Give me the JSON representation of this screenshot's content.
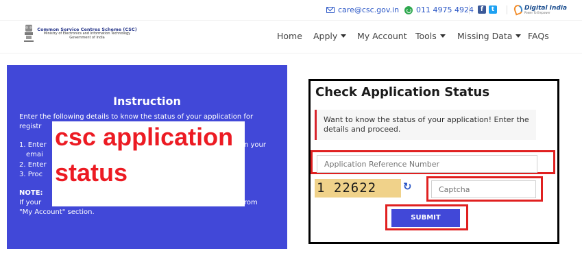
{
  "topbar": {
    "email": "care@csc.gov.in",
    "phone": "011 4975 4924",
    "social": [
      {
        "label": "f",
        "icon": "facebook-icon"
      },
      {
        "label": "t",
        "icon": "twitter-icon"
      }
    ],
    "digital_india": {
      "title": "Digital India",
      "tagline": "Power To Empower"
    }
  },
  "header": {
    "brand_line1": "Common Service Centres Scheme (CSC)",
    "brand_line2": "Ministry of Electronics and Information Technology",
    "brand_line3": "Government of India",
    "nav": [
      {
        "label": "Home",
        "dropdown": false
      },
      {
        "label": "Apply",
        "dropdown": true
      },
      {
        "label": "My Account",
        "dropdown": false
      },
      {
        "label": "Tools",
        "dropdown": true
      },
      {
        "label": "Missing Data",
        "dropdown": true
      },
      {
        "label": "FAQs",
        "dropdown": false
      }
    ]
  },
  "instruction": {
    "title": "Instruction",
    "lines": [
      "Enter the following details to know the status of your application for",
      "registr",
      "1. Enter",
      "n  your",
      "emai",
      "2. Enter",
      "3. Proc",
      "NOTE:",
      "If your",
      "rom",
      "\"My Account\" section."
    ]
  },
  "overlay": {
    "line1": "csc application",
    "line2": "status"
  },
  "status_form": {
    "title": "Check Application Status",
    "note": "Want to know the status of your application! Enter the details and proceed.",
    "reference_placeholder": "Application Reference Number",
    "captcha_text": "1 22622",
    "captcha_placeholder": "Captcha",
    "submit_label": "SUBMIT"
  },
  "colors": {
    "accent_blue": "#4148d8",
    "link_blue": "#2a56c6",
    "highlight_red": "#e02020"
  }
}
